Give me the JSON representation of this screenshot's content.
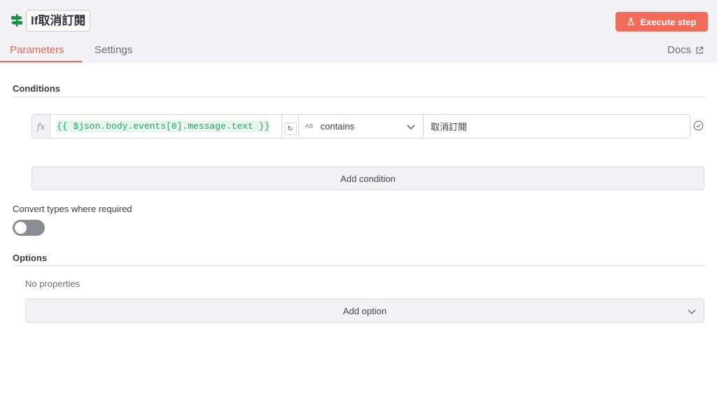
{
  "header": {
    "node_title": "If取消訂閱",
    "node_icon": "signpost-icon",
    "execute_label": "Execute step",
    "execute_icon": "flask-icon",
    "tabs": [
      {
        "label": "Parameters",
        "active": true
      },
      {
        "label": "Settings",
        "active": false
      }
    ],
    "docs_label": "Docs",
    "docs_icon": "external-link-icon",
    "accent_color": "#ef6553"
  },
  "conditions": {
    "label": "Conditions",
    "rows": [
      {
        "fx_label": "fx",
        "expression": "{{ $json.body.events[0].message.text }}",
        "operator_type": "AB",
        "operator": "contains",
        "value": "取消訂閱"
      }
    ],
    "add_label": "Add condition"
  },
  "convert_types": {
    "label": "Convert types where required",
    "enabled": false
  },
  "options": {
    "label": "Options",
    "empty_text": "No properties",
    "add_label": "Add option"
  }
}
